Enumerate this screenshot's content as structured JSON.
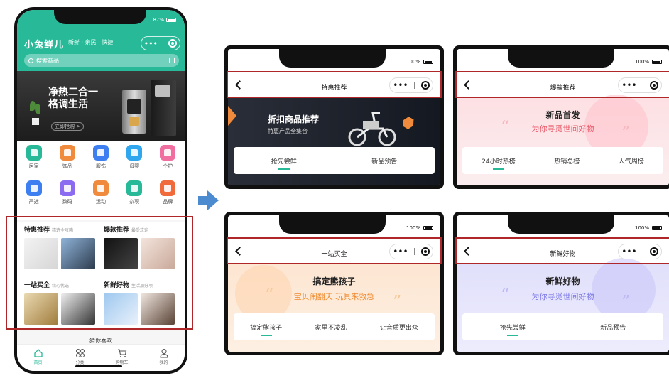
{
  "main": {
    "status_battery": "87%",
    "app_title": "小兔鲜儿",
    "slogan": "新鲜 · 亲民 · 快捷",
    "capsule_dots": "•••",
    "search_placeholder": "搜索商品",
    "banner_title": "净热二合一 格调生活",
    "banner_button": "立即抢购 >",
    "categories": [
      {
        "label": "居家",
        "color": "#27b998"
      },
      {
        "label": "饰品",
        "color": "#f08a3c"
      },
      {
        "label": "服饰",
        "color": "#3d7ff0"
      },
      {
        "label": "母婴",
        "color": "#2fa6ee"
      },
      {
        "label": "个护",
        "color": "#f06fa0"
      },
      {
        "label": "严选",
        "color": "#3d7ff0"
      },
      {
        "label": "数码",
        "color": "#8b6cf0"
      },
      {
        "label": "运动",
        "color": "#f08a3c"
      },
      {
        "label": "杂项",
        "color": "#27b998"
      },
      {
        "label": "品牌",
        "color": "#f06a3c"
      }
    ],
    "recommend": [
      {
        "title": "特惠推荐",
        "sub": "精选全攻略"
      },
      {
        "title": "爆款推荐",
        "sub": "最受欢迎"
      },
      {
        "title": "一站买全",
        "sub": "精心优选"
      },
      {
        "title": "新鲜好物",
        "sub": "生活加分项"
      }
    ],
    "more_label": "猜你喜欢",
    "tabs": [
      {
        "label": "首页"
      },
      {
        "label": "分类"
      },
      {
        "label": "购物车"
      },
      {
        "label": "我的"
      }
    ]
  },
  "pages": {
    "battery": "100%",
    "capsule_dots": "•••",
    "hot_preference": {
      "nav_title": "特惠推荐",
      "banner_title": "折扣商品推荐",
      "banner_sub": "特惠产品全集合",
      "tabs": [
        "抢先尝鲜",
        "新品预告"
      ]
    },
    "hot_sale": {
      "nav_title": "爆款推荐",
      "hero_title": "新品首发",
      "hero_sub": "为你寻觅世间好物",
      "tabs": [
        "24小时热榜",
        "热销总榜",
        "人气周榜"
      ]
    },
    "one_stop": {
      "nav_title": "一站买全",
      "hero_title": "搞定熊孩子",
      "hero_sub": "宝贝闹翻天 玩具来救急",
      "tabs": [
        "搞定熊孩子",
        "家里不凌乱",
        "让音质更出众"
      ]
    },
    "fresh": {
      "nav_title": "新鲜好物",
      "hero_title": "新鲜好物",
      "hero_sub": "为你寻觅世间好物",
      "tabs": [
        "抢先尝鲜",
        "新品预告"
      ]
    }
  },
  "colors": {
    "brand": "#27b998",
    "highlight_box": "#b0272a",
    "arrow": "#4d8bd0"
  }
}
